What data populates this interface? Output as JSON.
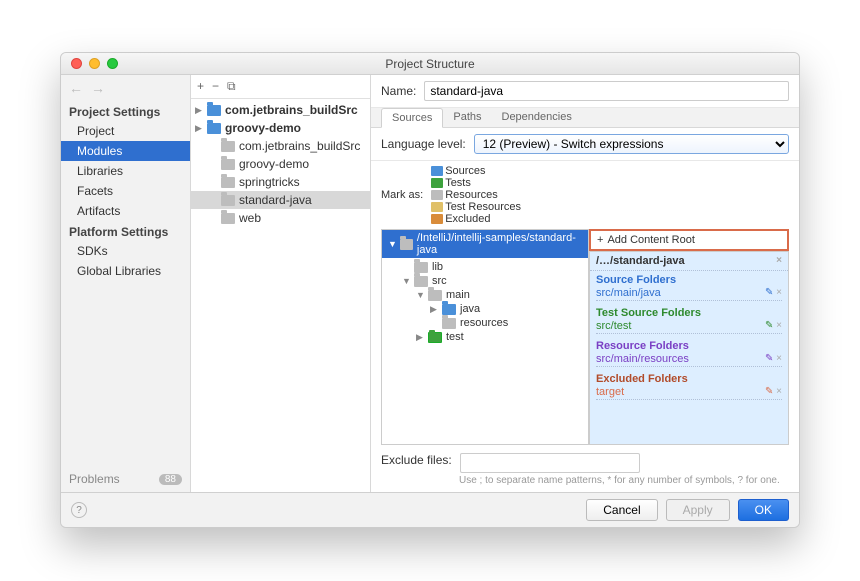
{
  "window": {
    "title": "Project Structure"
  },
  "sidebar": {
    "sections": [
      {
        "title": "Project Settings",
        "items": [
          "Project",
          "Modules",
          "Libraries",
          "Facets",
          "Artifacts"
        ],
        "selected": "Modules"
      },
      {
        "title": "Platform Settings",
        "items": [
          "SDKs",
          "Global Libraries"
        ]
      }
    ],
    "problems_label": "Problems",
    "problems_count": "88"
  },
  "modules": {
    "toolbar": {
      "add": "+",
      "remove": "−",
      "copy": "⧉"
    },
    "items": [
      {
        "label": "com.jetbrains_buildSrc",
        "bold": true,
        "indent": 0
      },
      {
        "label": "groovy-demo",
        "bold": true,
        "indent": 0
      },
      {
        "label": "com.jetbrains_buildSrc",
        "indent": 1,
        "grey": true
      },
      {
        "label": "groovy-demo",
        "indent": 1,
        "grey": true
      },
      {
        "label": "springtricks",
        "indent": 1,
        "grey": true
      },
      {
        "label": "standard-java",
        "indent": 1,
        "grey": true,
        "selected": true
      },
      {
        "label": "web",
        "indent": 1,
        "grey": true
      }
    ]
  },
  "form": {
    "name_label": "Name:",
    "name_value": "standard-java",
    "tabs": [
      "Sources",
      "Paths",
      "Dependencies"
    ],
    "active_tab": "Sources",
    "lang_label": "Language level:",
    "lang_value": "12 (Preview) - Switch expressions",
    "mark_label": "Mark as:",
    "marks": [
      {
        "color": "c-src",
        "label": "Sources"
      },
      {
        "color": "c-test",
        "label": "Tests"
      },
      {
        "color": "c-res",
        "label": "Resources"
      },
      {
        "color": "c-tres",
        "label": "Test Resources"
      },
      {
        "color": "c-exc",
        "label": "Excluded"
      }
    ]
  },
  "source_tree": {
    "root": "/IntelliJ/intellij-samples/standard-java",
    "nodes": [
      {
        "indent": 1,
        "tri": "",
        "cls": "grey",
        "label": "lib"
      },
      {
        "indent": 1,
        "tri": "▼",
        "cls": "grey",
        "label": "src"
      },
      {
        "indent": 2,
        "tri": "▼",
        "cls": "grey",
        "label": "main"
      },
      {
        "indent": 3,
        "tri": "▶",
        "cls": "blue",
        "label": "java"
      },
      {
        "indent": 3,
        "tri": "",
        "cls": "grey",
        "label": "resources"
      },
      {
        "indent": 2,
        "tri": "▶",
        "cls": "green",
        "label": "test"
      }
    ]
  },
  "roots": {
    "add_label": "Add Content Root",
    "path_label": "/…/standard-java",
    "groups": [
      {
        "cls": "g-src",
        "title": "Source Folders",
        "items": [
          "src/main/java"
        ]
      },
      {
        "cls": "g-test",
        "title": "Test Source Folders",
        "items": [
          "src/test"
        ]
      },
      {
        "cls": "g-res",
        "title": "Resource Folders",
        "items": [
          "src/main/resources"
        ]
      },
      {
        "cls": "g-exc",
        "title": "Excluded Folders",
        "items": [
          "target"
        ]
      }
    ]
  },
  "exclude": {
    "label": "Exclude files:",
    "hint": "Use ; to separate name patterns, * for any number of symbols, ? for one."
  },
  "footer": {
    "cancel": "Cancel",
    "apply": "Apply",
    "ok": "OK"
  }
}
